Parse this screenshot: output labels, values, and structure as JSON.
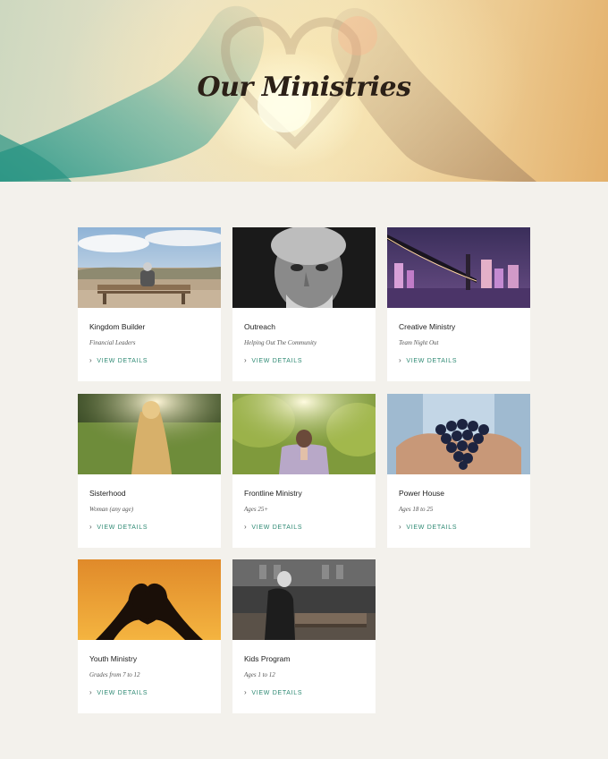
{
  "hero": {
    "title": "Our Ministries"
  },
  "cards": [
    {
      "title": "Kingdom Builder",
      "subtitle": "Financial Leaders",
      "link": "VIEW DETAILS",
      "image": "man on bench photo"
    },
    {
      "title": "Outreach",
      "subtitle": "Helping Out The Community",
      "link": "VIEW DETAILS",
      "image": "elderly man portrait photo"
    },
    {
      "title": "Creative Ministry",
      "subtitle": "Team Night Out",
      "link": "VIEW DETAILS",
      "image": "city bridge at night photo"
    },
    {
      "title": "Sisterhood",
      "subtitle": "Woman (any age)",
      "link": "VIEW DETAILS",
      "image": "woman in field photo"
    },
    {
      "title": "Frontline Ministry",
      "subtitle": "Ages 25+",
      "link": "VIEW DETAILS",
      "image": "man praying photo"
    },
    {
      "title": "Power House",
      "subtitle": "Ages 18 to 25",
      "link": "VIEW DETAILS",
      "image": "hands holding grapes photo"
    },
    {
      "title": "Youth Ministry",
      "subtitle": "Grades from 7 to 12",
      "link": "VIEW DETAILS",
      "image": "heart hands sunset photo"
    },
    {
      "title": "Kids Program",
      "subtitle": "Ages 1 to 12",
      "link": "VIEW DETAILS",
      "image": "old man in church photo"
    }
  ],
  "icons": {
    "link_chevron": "chevron-right-icon"
  },
  "colors": {
    "accent": "#2f8a74",
    "background": "#f3f1ec",
    "card": "#ffffff",
    "title_text": "#2b2017"
  }
}
